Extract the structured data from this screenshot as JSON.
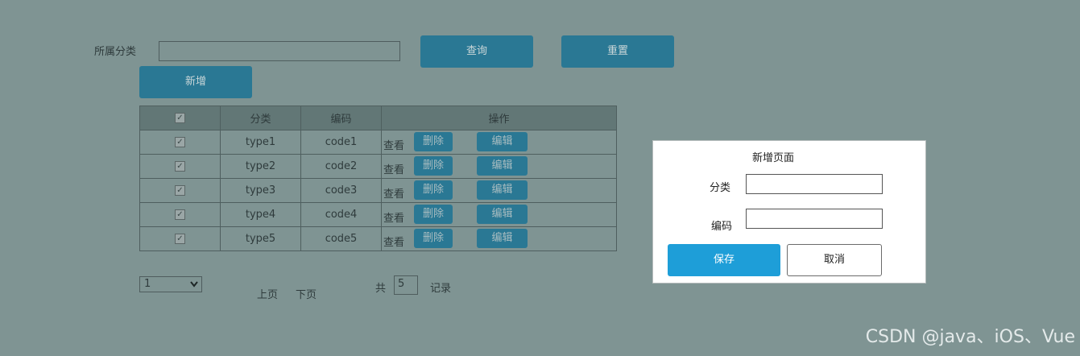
{
  "filter": {
    "category_label": "所属分类",
    "category_value": "",
    "query_label": "查询",
    "reset_label": "重置",
    "add_label": "新增"
  },
  "table": {
    "headers": [
      "",
      "分类",
      "编码",
      "操作"
    ],
    "rows": [
      {
        "type": "type1",
        "code": "code1"
      },
      {
        "type": "type2",
        "code": "code2"
      },
      {
        "type": "type3",
        "code": "code3"
      },
      {
        "type": "type4",
        "code": "code4"
      },
      {
        "type": "type5",
        "code": "code5"
      }
    ],
    "view_label": "查看",
    "delete_label": "删除",
    "edit_label": "编辑",
    "check_glyph": "✓"
  },
  "pagination": {
    "page_selected": "1",
    "prev_label": "上页",
    "next_label": "下页",
    "total_prefix": "共",
    "total_count": "5",
    "total_suffix": "记录"
  },
  "modal": {
    "title": "新增页面",
    "category_label": "分类",
    "code_label": "编码",
    "save_label": "保存",
    "cancel_label": "取消",
    "save_color": "#1e9ed8"
  },
  "watermark": "CSDN @java、iOS、Vue"
}
